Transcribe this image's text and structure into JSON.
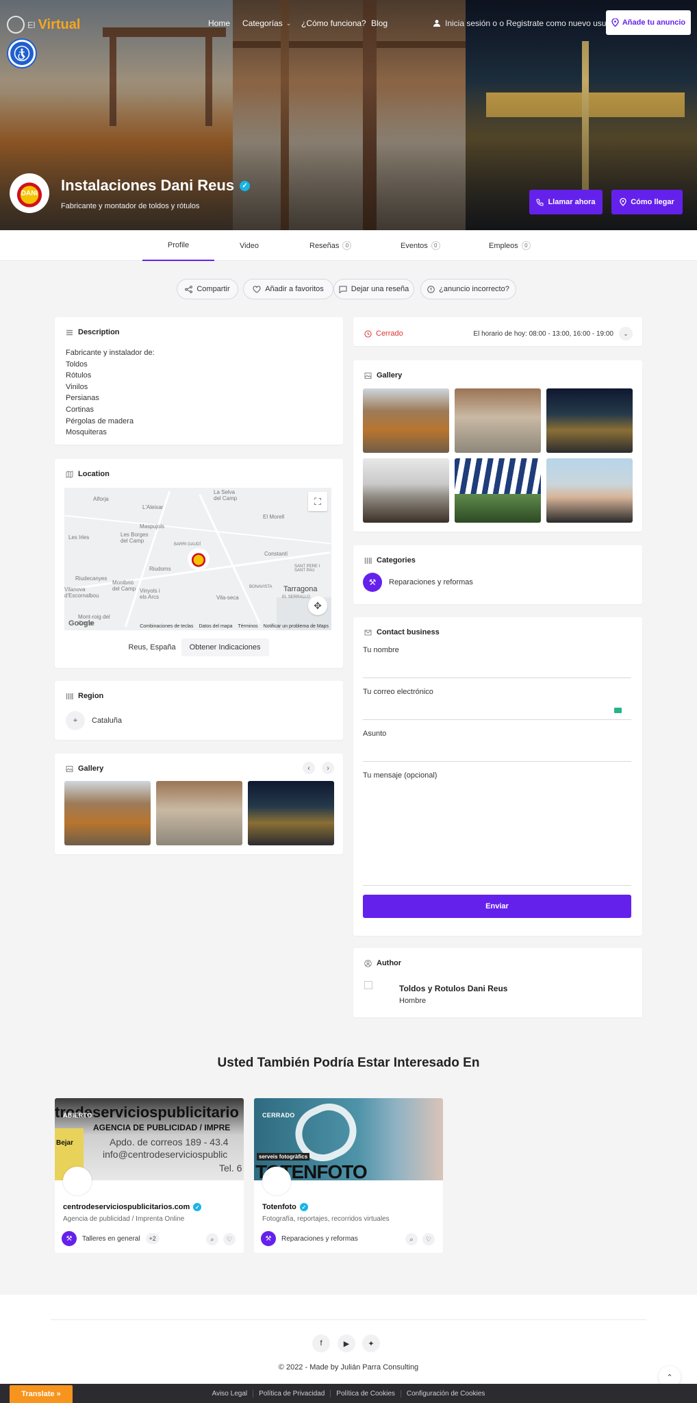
{
  "brand": {
    "line1": "El",
    "line2": "Virtual"
  },
  "nav": {
    "home": "Home",
    "categorias": "Categorías",
    "como": "¿Cómo funciona?",
    "blog": "Blog",
    "login": "Inicia sesión o o Registrate como nuevo usuario",
    "add_listing": "Añade tu anuncio"
  },
  "business": {
    "name": "Instalaciones Dani Reus",
    "tagline": "Fabricante y montador de toldos y rótulos",
    "avatar_text": "DANI",
    "call_label": "Llamar ahora",
    "directions_label": "Cómo llegar"
  },
  "tabs": [
    {
      "label": "Profile"
    },
    {
      "label": "Video"
    },
    {
      "label": "Reseñas",
      "count": "0"
    },
    {
      "label": "Eventos",
      "count": "0"
    },
    {
      "label": "Empleos",
      "count": "0"
    }
  ],
  "actions": {
    "share": "Compartir",
    "favorite": "Añadir a favoritos",
    "review": "Dejar una reseña",
    "report": "¿anuncio incorrecto?"
  },
  "description": {
    "title": "Description",
    "lines": [
      "Fabricante y instalador de:",
      "Toldos",
      "Rótulos",
      "Vinilos",
      "Persianas",
      "Cortinas",
      "Pérgolas de madera",
      "Mosquiteras"
    ]
  },
  "location": {
    "title": "Location",
    "map_labels": [
      "Alforja",
      "L'Aleixar",
      "La Selva del Camp",
      "El Morell",
      "Maspujols",
      "Les Irles",
      "Les Borges del Camp",
      "BARRI GAUDÍ",
      "Constantí",
      "Riudoms",
      "Riudecanyes",
      "Montbrió del Camp",
      "Vinyols i els Arcs",
      "Vila-seca",
      "BONAVISTA",
      "SANT PERE I SANT PAU",
      "Tarragona",
      "EL SERRALLO",
      "Vilanova d'Escornalbou",
      "Mont-roig del Camp"
    ],
    "map_footer": [
      "Combinaciones de teclas",
      "Datos del mapa",
      "Términos",
      "Notificar un problema de Maps"
    ],
    "google": "Google",
    "address": "Reus, España",
    "directions": "Obtener Indicaciones"
  },
  "region": {
    "title": "Region",
    "value": "Cataluña"
  },
  "gallery_left": {
    "title": "Gallery"
  },
  "hours": {
    "status": "Cerrado",
    "today": "El horario de hoy: 08:00 - 13:00, 16:00 - 19:00"
  },
  "gallery_right": {
    "title": "Gallery"
  },
  "categories": {
    "title": "Categories",
    "item": "Reparaciones y reformas"
  },
  "contact": {
    "title": "Contact business",
    "name_label": "Tu nombre",
    "email_label": "Tu correo electrónico",
    "subject_label": "Asunto",
    "message_label": "Tu mensaje (opcional)",
    "send": "Enviar"
  },
  "author": {
    "title": "Author",
    "name": "Toldos y Rotulos Dani Reus",
    "gender": "Hombre"
  },
  "related": {
    "title": "Usted También Podría Estar Interesado En",
    "cards": [
      {
        "status": "ABIERTO",
        "image_text1": "trodeserviciospublicitario",
        "image_text2": "AGENCIA DE PUBLICIDAD / IMPRE",
        "image_text3": "Apdo. de correos 189 - 43.4",
        "image_text4": "info@centrodeserviciospublic",
        "image_text5": "Tel. 6",
        "image_text6": "Bejar",
        "name": "centrodeserviciospublicitarios.com",
        "sub": "Agencia de publicidad / Imprenta Online",
        "category": "Talleres en general",
        "more": "+2"
      },
      {
        "status": "CERRADO",
        "image_text1": "serveis fotogràfics",
        "image_text2": "TOTENFOTO",
        "name": "Totenfoto",
        "sub": "Fotografía, reportajes, recorridos virtuales",
        "category": "Reparaciones y reformas"
      }
    ]
  },
  "footer": {
    "copyright": "© 2022 - Made by Julián Parra Consulting",
    "links": [
      "Aviso Legal",
      "Política de Privacidad",
      "Política de Cookies",
      "Configuración de Cookies"
    ],
    "translate": "Translate »"
  },
  "colors": {
    "accent": "#6521ec",
    "verified": "#19b4e6",
    "closed": "#dd3333",
    "translate": "#f7941d"
  }
}
